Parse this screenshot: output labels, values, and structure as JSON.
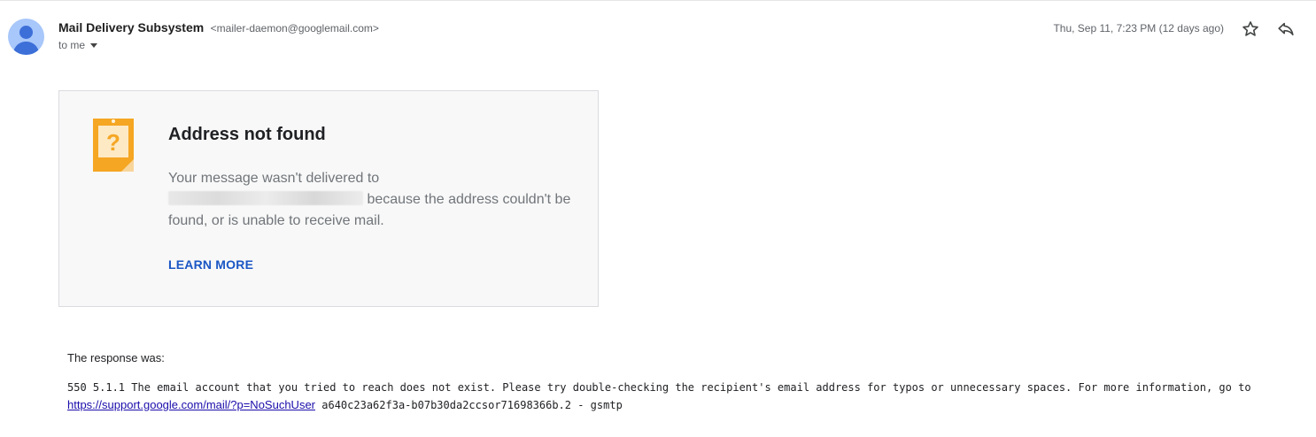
{
  "header": {
    "sender_name": "Mail Delivery Subsystem",
    "sender_email": "<mailer-daemon@googlemail.com>",
    "recipient_label": "to me",
    "date": "Thu, Sep 11, 7:23 PM (12 days ago)",
    "icons": {
      "avatar": "person-avatar",
      "star": "star-icon",
      "reply": "reply-icon",
      "caret": "caret-down-icon"
    }
  },
  "card": {
    "title": "Address not found",
    "message_before": "Your message wasn't delivered to",
    "message_after": "because the address couldn't be found, or is unable to receive mail.",
    "learn_more": "LEARN MORE",
    "icon": "question-note-icon"
  },
  "response": {
    "intro": "The response was:",
    "line1": "550 5.1.1 The email account that you tried to reach does not exist. Please try double-checking the recipient's email address for typos or unnecessary spaces. For more information, go to",
    "link": "https://support.google.com/mail/?p=NoSuchUser",
    "line2_rest": " a640c23a62f3a-b07b30da2ccsor71698366b.2 - gsmtp"
  },
  "colors": {
    "accent_blue": "#1a56c4",
    "link_blue": "#1a0dab",
    "note_orange": "#f5a623"
  }
}
